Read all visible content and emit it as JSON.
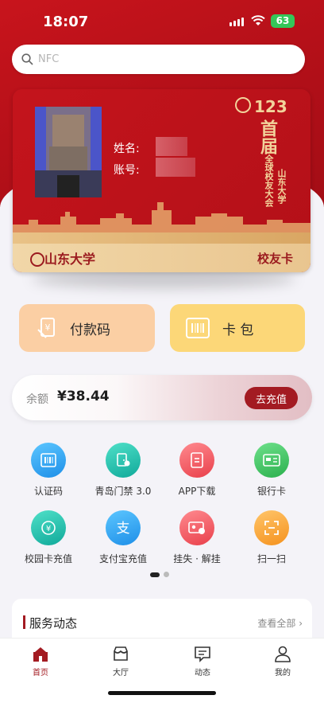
{
  "status_bar": {
    "time": "18:07",
    "battery": "63"
  },
  "search": {
    "placeholder": "NFC"
  },
  "card": {
    "name_label": "姓名:",
    "account_label": "账号:",
    "anniversary": "123",
    "title_main": "首届",
    "title_sub_1": "山东大学",
    "title_sub_2": "全球校友大会",
    "university": "山东大学",
    "card_type": "校友卡"
  },
  "actions": {
    "pay_code": "付款码",
    "wallet": "卡 包"
  },
  "balance": {
    "label": "余额",
    "value": "¥38.44",
    "recharge": "去充值"
  },
  "grid": [
    {
      "label": "认证码",
      "icon": "barcode-icon",
      "color": "#2fa8f0"
    },
    {
      "label": "青岛门禁 3.0",
      "icon": "door-access-icon",
      "color": "#22bfae"
    },
    {
      "label": "APP下载",
      "icon": "app-download-icon",
      "color": "#f0525c"
    },
    {
      "label": "银行卡",
      "icon": "bank-card-icon",
      "color": "#3fc45a"
    },
    {
      "label": "校园卡充值",
      "icon": "campus-card-recharge-icon",
      "color": "#20c4b2"
    },
    {
      "label": "支付宝充值",
      "icon": "alipay-icon",
      "color": "#2fa8f0"
    },
    {
      "label": "挂失 · 解挂",
      "icon": "report-loss-icon",
      "color": "#f0525c"
    },
    {
      "label": "扫一扫",
      "icon": "scan-icon",
      "color": "#f8a53a"
    }
  ],
  "service": {
    "title": "服务动态",
    "more": "查看全部"
  },
  "tabs": [
    {
      "label": "首页",
      "icon": "home-icon"
    },
    {
      "label": "大厅",
      "icon": "hall-icon"
    },
    {
      "label": "动态",
      "icon": "message-icon"
    },
    {
      "label": "我的",
      "icon": "profile-icon"
    }
  ],
  "colors": {
    "brand_red": "#b00f18",
    "accent_dark_red": "#a31b22",
    "gold": "#f2d39b"
  }
}
